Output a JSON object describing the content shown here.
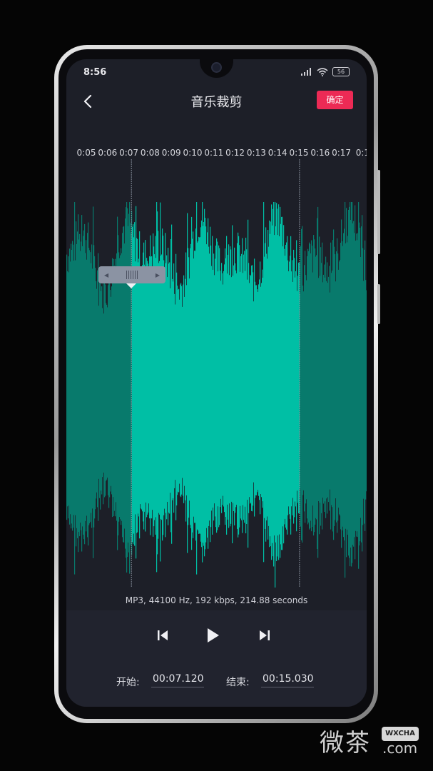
{
  "status_bar": {
    "time": "8:56",
    "battery": "56"
  },
  "nav": {
    "title": "音乐裁剪",
    "confirm_label": "确定",
    "back_icon": "chevron-left-icon"
  },
  "timeline": {
    "ticks": [
      "0:05",
      "0:06",
      "0:07",
      "0:08",
      "0:09",
      "0:10",
      "0:11",
      "0:12",
      "0:13",
      "0:14",
      "0:15",
      "0:16",
      "0:17",
      "0:1"
    ]
  },
  "selection": {
    "start_seconds": 7.12,
    "end_seconds": 15.03,
    "visible_from": 5.0,
    "visible_to": 18.0
  },
  "audio_info": "MP3, 44100 Hz, 192 kbps, 214.88 seconds",
  "controls": {
    "prev_icon": "skip-previous-icon",
    "play_icon": "play-icon",
    "next_icon": "skip-next-icon",
    "start_label": "开始:",
    "start_value": "00:07.120",
    "end_label": "结束:",
    "end_value": "00:15.030"
  },
  "colors": {
    "wave_selected": "#00bfa5",
    "wave_unselected": "#087a6c",
    "confirm": "#ec2a55",
    "end_handle_border": "#f2c232"
  },
  "watermark": {
    "text": "微茶",
    "badge": "WXCHA",
    "suffix": ".com"
  }
}
